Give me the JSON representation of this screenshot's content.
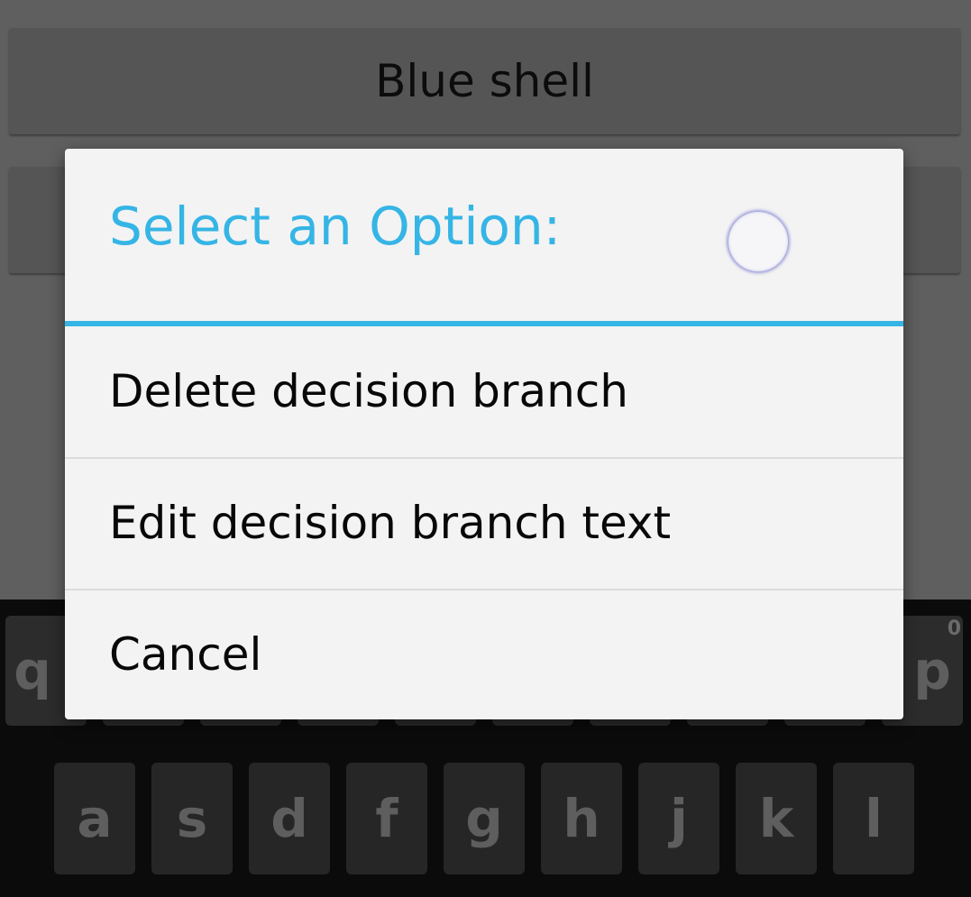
{
  "app": {
    "buttons": [
      "Blue shell",
      ""
    ]
  },
  "keyboard": {
    "top_row_left": "q",
    "top_row_right": "p",
    "top_row_right_hint": "0",
    "middle_row": [
      "a",
      "s",
      "d",
      "f",
      "g",
      "h",
      "j",
      "k",
      "l"
    ]
  },
  "dialog": {
    "title": "Select an Option:",
    "options": [
      "Delete decision branch",
      "Edit decision branch text",
      "Cancel"
    ],
    "accent_color": "#35b5e5"
  }
}
